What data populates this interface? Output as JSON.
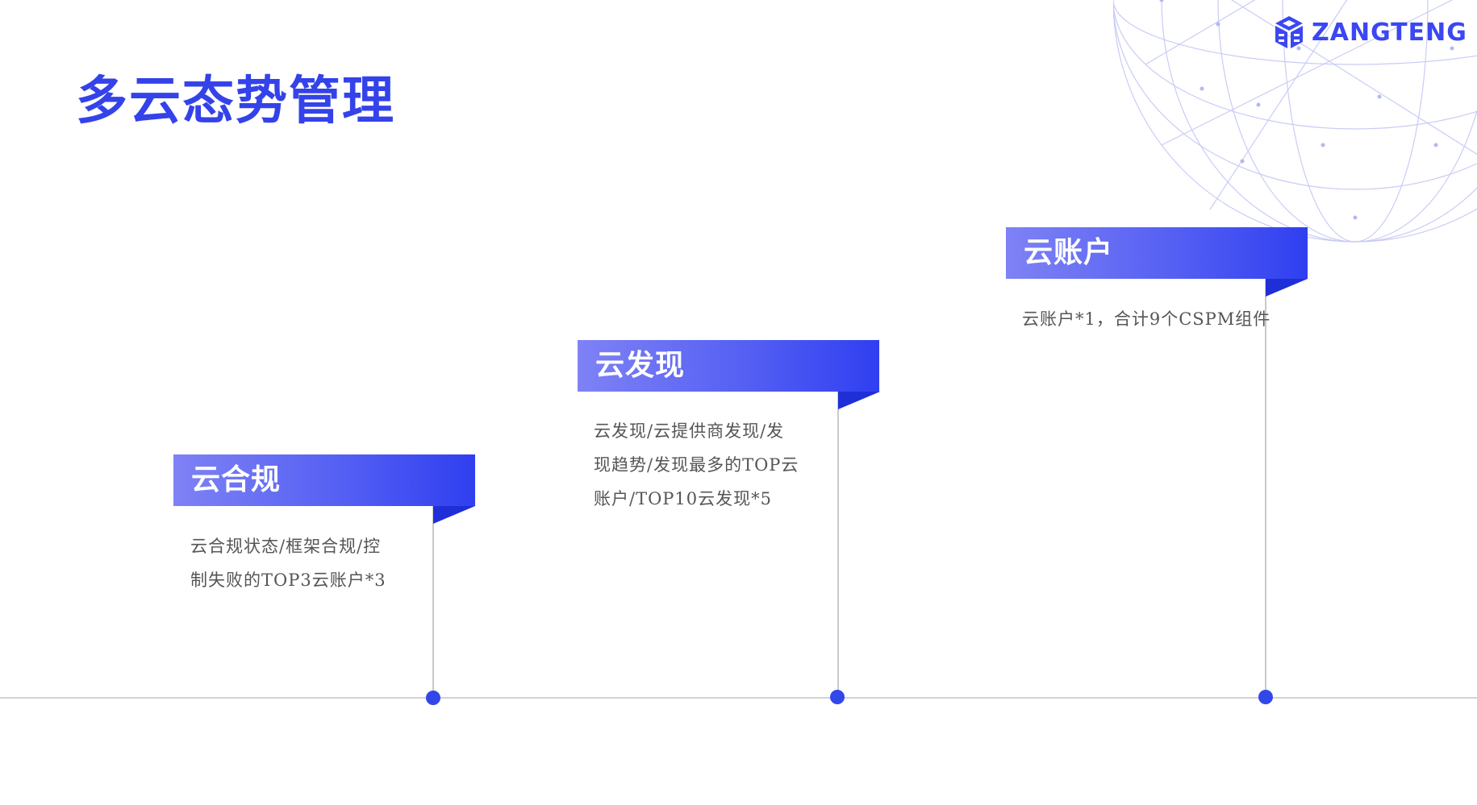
{
  "logo": {
    "text": "ZANGTENG"
  },
  "title": "多云态势管理",
  "steps": [
    {
      "title": "云合规",
      "desc_lines": [
        "云合规状态/框架合规/控",
        "制失败的TOP3云账户*3"
      ]
    },
    {
      "title": "云发现",
      "desc_lines": [
        "云发现/云提供商发现/发",
        "现趋势/发现最多的TOP云",
        "账户/TOP10云发现*5"
      ]
    },
    {
      "title": "云账户",
      "desc_lines": [
        "云账户*1，合计9个CSPM组件"
      ]
    }
  ],
  "colors": {
    "brand": "#3442ea",
    "banner_start": "#7f82f5",
    "banner_end": "#2f3ff0",
    "dot": "#3247ea"
  },
  "icons": {
    "logo": "zangteng-cube-logo",
    "background": "wireframe-globe"
  }
}
